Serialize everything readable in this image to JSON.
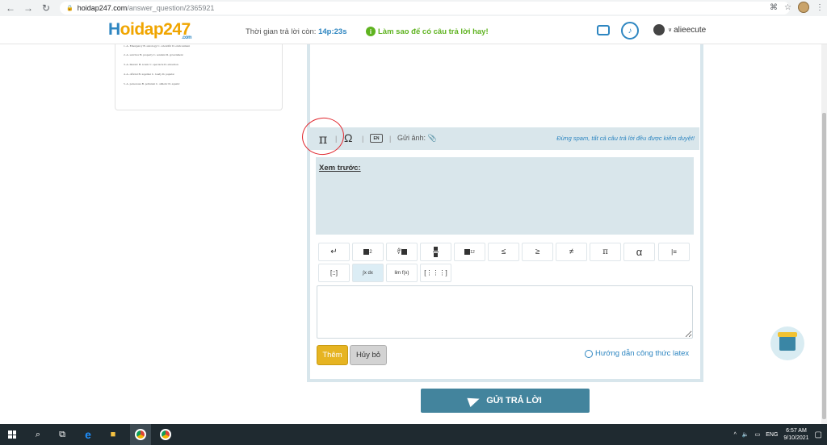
{
  "browser": {
    "url_host": "hoidap247.com",
    "url_path": "/answer_question/2365921"
  },
  "header": {
    "logo_text": "oidap247",
    "logo_first_letter": "H",
    "logo_com": ".com",
    "timer_label": "Thời gian trả lời còn:",
    "timer_value": "14p:23s",
    "tip_text": "Làm sao để có câu trả lời hay!",
    "username": "alieecute"
  },
  "question_card": {
    "lines": [
      "1. A. Emergency  B. astrology  C. scientific  D. environment",
      "2. A. survivor   B. property   C. sendant   D. government",
      "3. A. historic   B. iconic    C. spectacle  D. attraction",
      "4. A. official   B. together   C. loudy    D. popular",
      "5. A. poisonous  B. pollutant  C. athletic  D. aquatic"
    ]
  },
  "editor_toolbar": {
    "pi_symbol": "π",
    "omega_symbol": "Ω",
    "keyboard_label": "EN",
    "upload_label": "Gửi ảnh:",
    "notice": "Đừng spam, tất cả câu trả lời đều được kiểm duyệt!"
  },
  "preview": {
    "label": "Xem trước:"
  },
  "math_buttons": {
    "row1": [
      "↵",
      "■²",
      "√■",
      "■/■",
      "■₁₂",
      "≤",
      "≥",
      "≠",
      "π",
      "α",
      "|≡"
    ],
    "row2": [
      "[::]",
      "∫x dx",
      "lim",
      "[⋮⋮⋮]"
    ],
    "lim_label": "lim f(x)"
  },
  "actions": {
    "add_label": "Thêm",
    "cancel_label": "Hủy bỏ",
    "latex_help": "Hướng dẫn công thức latex",
    "submit_label": "GỬI TRẢ LỜI"
  },
  "taskbar": {
    "lang": "ENG",
    "time": "6:57 AM",
    "date": "9/10/2021"
  },
  "colors": {
    "accent_blue": "#2e86c1",
    "submit_bg": "#43849d",
    "add_btn": "#e6b422",
    "tip_green": "#5fb320",
    "annotation_red": "#e0262d"
  }
}
